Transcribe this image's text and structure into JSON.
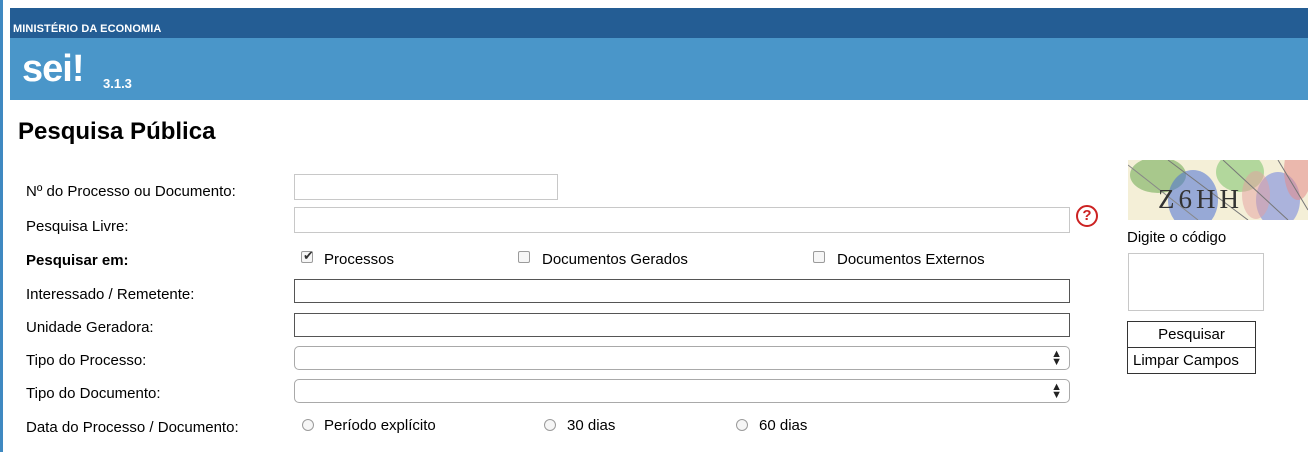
{
  "header": {
    "ministry": "MINISTÉRIO DA ECONOMIA",
    "logo": "sei!",
    "version": "3.1.3"
  },
  "page_title": "Pesquisa Pública",
  "form": {
    "process_number_label": "Nº do Processo ou Documento:",
    "free_search_label": "Pesquisa Livre:",
    "search_in_label": "Pesquisar em:",
    "search_in_options": [
      {
        "label": "Processos",
        "checked": true
      },
      {
        "label": "Documentos Gerados",
        "checked": false
      },
      {
        "label": "Documentos Externos",
        "checked": false
      }
    ],
    "interested_label": "Interessado / Remetente:",
    "unit_label": "Unidade Geradora:",
    "process_type_label": "Tipo do Processo:",
    "document_type_label": "Tipo do Documento:",
    "date_label": "Data do Processo / Documento:",
    "date_options": [
      {
        "label": "Período explícito",
        "selected": false
      },
      {
        "label": "30 dias",
        "selected": false
      },
      {
        "label": "60 dias",
        "selected": false
      }
    ]
  },
  "captcha": {
    "image_text": "Z6HH",
    "prompt": "Digite o código"
  },
  "buttons": {
    "search": "Pesquisar",
    "clear": "Limpar Campos"
  },
  "icons": {
    "help": "help-icon",
    "checkbox_checked": "check-icon",
    "select_arrows": "updown-arrows-icon"
  },
  "colors": {
    "header_dark": "#245d94",
    "header_banner": "#4a96c9",
    "help_red": "#cc2222"
  }
}
